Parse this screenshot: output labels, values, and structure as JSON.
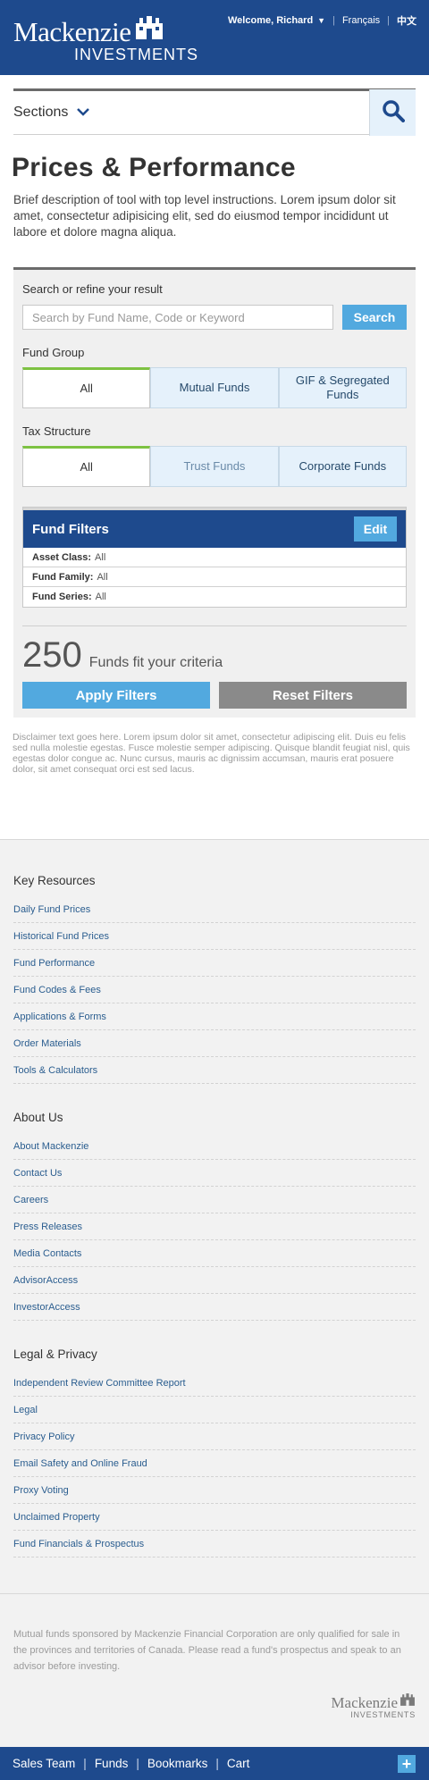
{
  "header": {
    "logo_main": "Mackenzie",
    "logo_sub": "INVESTMENTS",
    "welcome": "Welcome, Richard",
    "french": "Français",
    "chinese": "中文"
  },
  "nav": {
    "sections_label": "Sections"
  },
  "page": {
    "title": "Prices & Performance",
    "description": "Brief description of tool with top level instructions. Lorem ipsum dolor sit amet, consectetur adipisicing elit, sed do eiusmod tempor incididunt ut labore et dolore magna aliqua."
  },
  "search": {
    "label": "Search or refine your result",
    "placeholder": "Search by Fund Name, Code or Keyword",
    "button": "Search"
  },
  "fund_group": {
    "label": "Fund Group",
    "options": [
      "All",
      "Mutual Funds",
      "GIF & Segregated Funds"
    ],
    "selected": "All"
  },
  "tax_structure": {
    "label": "Tax Structure",
    "options": [
      "All",
      "Trust Funds",
      "Corporate Funds"
    ],
    "selected": "All"
  },
  "fund_filters": {
    "title": "Fund Filters",
    "edit": "Edit",
    "rows": [
      {
        "key": "Asset Class:",
        "value": "All"
      },
      {
        "key": "Fund Family:",
        "value": "All"
      },
      {
        "key": "Fund Series:",
        "value": "All"
      }
    ]
  },
  "results": {
    "count": "250",
    "text": "Funds fit your criteria",
    "apply": "Apply Filters",
    "reset": "Reset Filters"
  },
  "disclaimer": "Disclaimer text goes here. Lorem ipsum dolor sit amet, consectetur adipiscing elit. Duis eu felis sed nulla molestie egestas. Fusce molestie semper adipiscing. Quisque blandit feugiat nisl, quis egestas dolor congue ac. Nunc cursus, mauris ac dignissim accumsan, mauris erat posuere dolor, sit amet consequat orci est sed lacus.",
  "footer": {
    "sections": [
      {
        "title": "Key Resources",
        "links": [
          "Daily Fund Prices",
          "Historical Fund Prices",
          "Fund Performance",
          "Fund Codes & Fees",
          "Applications & Forms",
          "Order Materials",
          "Tools & Calculators"
        ]
      },
      {
        "title": "About Us",
        "links": [
          "About Mackenzie",
          "Contact Us",
          "Careers",
          "Press Releases",
          "Media Contacts",
          "AdvisorAccess",
          "InvestorAccess"
        ]
      },
      {
        "title": "Legal & Privacy",
        "links": [
          "Independent Review Committee Report",
          "Legal",
          "Privacy Policy",
          "Email Safety and Online Fraud",
          "Proxy Voting",
          "Unclaimed Property",
          "Fund Financials & Prospectus"
        ]
      }
    ],
    "legal_text": "Mutual funds sponsored by Mackenzie Financial Corporation are only qualified for sale in the provinces and territories of Canada. Please read a fund's prospectus and speak to an advisor before investing.",
    "logo_main": "Mackenzie",
    "logo_sub": "INVESTMENTS"
  },
  "bottom_bar": {
    "items": [
      "Sales Team",
      "Funds",
      "Bookmarks",
      "Cart"
    ],
    "plus": "+"
  },
  "colors": {
    "brand_blue": "#1e4a8d",
    "accent_blue": "#52a9df",
    "active_green": "#7dc242"
  },
  "icons": [
    "castle-logo-icon",
    "caret-down-icon",
    "chevron-down-icon",
    "search-icon",
    "plus-icon"
  ]
}
